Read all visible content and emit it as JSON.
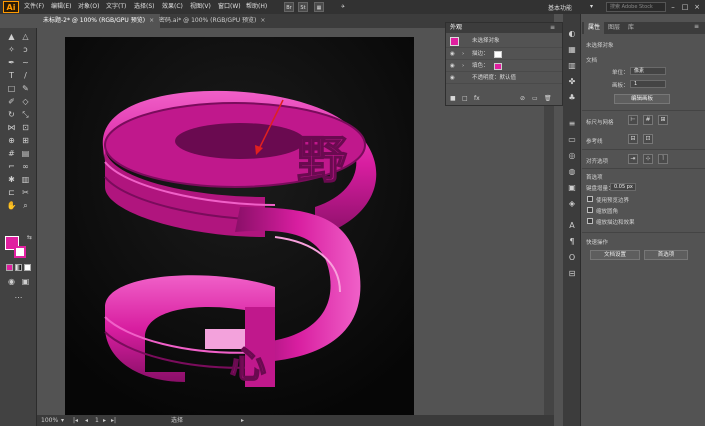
{
  "app": {
    "logo": "Ai"
  },
  "menu": [
    "文件(F)",
    "编辑(E)",
    "对象(O)",
    "文字(T)",
    "选择(S)",
    "效果(C)",
    "视图(V)",
    "窗口(W)",
    "帮助(H)"
  ],
  "toolbar_btns": [
    "Br",
    "St"
  ],
  "workspace": {
    "label": "基本功能",
    "search_placeholder": "搜索 Adobe Stock"
  },
  "tabs": [
    {
      "label": "未标题-2* @ 100% (RGB/GPU 预览)",
      "active": true
    },
    {
      "label": "密码.ai* @ 100% (RGB/GPU 预览)",
      "active": false
    }
  ],
  "appearance": {
    "title": "外观",
    "object": "未选择对象",
    "stroke_label": "描边：",
    "fill_label": "填色：",
    "opacity": "不透明度：默认值",
    "fill_color": "#e020a0"
  },
  "props_tabs": [
    "属性",
    "图层",
    "库"
  ],
  "props": {
    "no_selection": "未选择对象",
    "document": "文档",
    "units_label": "单位：",
    "units_value": "像素",
    "artboard_label": "画板：",
    "artboard_value": "1",
    "edit_artboard": "编辑画板",
    "rulers_grid": "标尺与网格",
    "guides": "参考线",
    "align_objects": "对齐选项",
    "preferences": "首选项",
    "keyboard_increment_label": "键盘增量：",
    "keyboard_increment_value": "0.05 px",
    "cb1": "使用预览边界",
    "cb2": "缩放圆角",
    "cb3": "缩放描边和效果",
    "quick_actions": "快速操作",
    "doc_setup": "文档设置",
    "preferences_btn": "首选项"
  },
  "status": {
    "zoom": "100%",
    "artboard": "1",
    "tool": "选择"
  },
  "art": {
    "char1": "野",
    "char2": "心",
    "magenta": "#d81ea0",
    "magenta_dark": "#8a0f68",
    "magenta_light": "#f060c8"
  }
}
